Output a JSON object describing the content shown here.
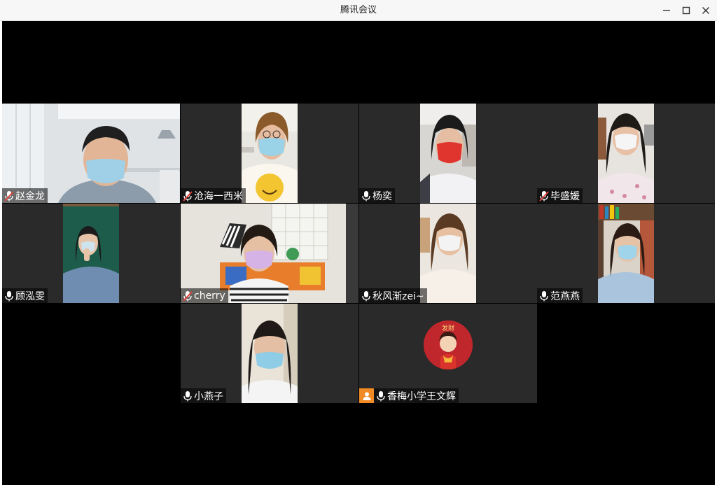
{
  "window": {
    "title": "腾讯会议",
    "controls": [
      "minimize",
      "maximize",
      "close"
    ]
  },
  "participants": [
    {
      "name": "赵金龙",
      "mic": "muted"
    },
    {
      "name": "沧海一西米",
      "mic": "muted"
    },
    {
      "name": "杨奕",
      "mic": "on"
    },
    {
      "name": "毕盛媛",
      "mic": "muted"
    },
    {
      "name": "顾泓雯",
      "mic": "on"
    },
    {
      "name": "cherry",
      "mic": "muted"
    },
    {
      "name": "秋风渐zei~",
      "mic": "on"
    },
    {
      "name": "范燕燕",
      "mic": "on"
    },
    {
      "name": "小燕子",
      "mic": "on"
    },
    {
      "name": "香梅小学王文辉",
      "mic": "on",
      "video": "off",
      "badge": "person-icon"
    }
  ],
  "colors": {
    "stage_bg": "#000000",
    "tile_bg": "#2a2a2a",
    "muted_slash": "#e0403a",
    "badge": "#f08a24",
    "avatar_bg": "#c0272d"
  }
}
